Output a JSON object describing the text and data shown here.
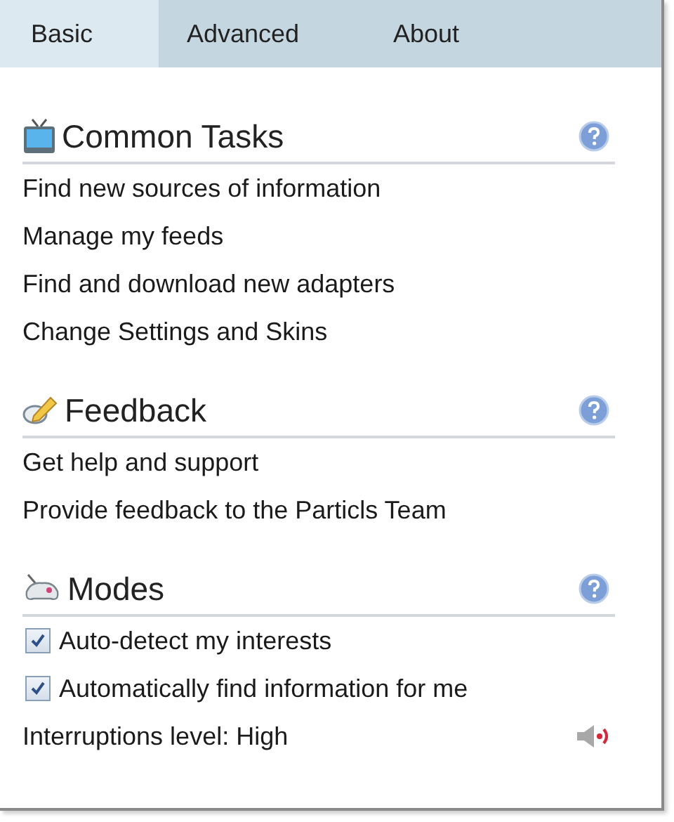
{
  "tabs": [
    {
      "label": "Basic",
      "selected": true
    },
    {
      "label": "Advanced",
      "selected": false
    },
    {
      "label": "About",
      "selected": false
    }
  ],
  "sections": [
    {
      "title": "Common Tasks",
      "items": [
        {
          "kind": "link",
          "label": "Find new sources of information"
        },
        {
          "kind": "link",
          "label": "Manage my feeds"
        },
        {
          "kind": "link",
          "label": "Find and download new adapters"
        },
        {
          "kind": "link",
          "label": "Change Settings and Skins"
        }
      ]
    },
    {
      "title": "Feedback",
      "items": [
        {
          "kind": "link",
          "label": "Get help and support"
        },
        {
          "kind": "link",
          "label": "Provide feedback to the Particls Team"
        }
      ]
    },
    {
      "title": "Modes",
      "items": [
        {
          "kind": "checkbox",
          "label": "Auto-detect my interests",
          "checked": true
        },
        {
          "kind": "checkbox",
          "label": "Automatically find information for me",
          "checked": true
        },
        {
          "kind": "level",
          "label": "Interruptions level: High"
        }
      ]
    }
  ]
}
